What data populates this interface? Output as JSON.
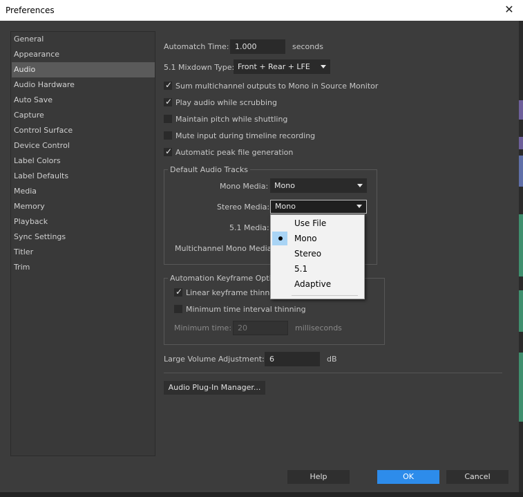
{
  "window": {
    "title": "Preferences",
    "close_icon": "close-icon"
  },
  "sidebar": {
    "items": [
      {
        "label": "General"
      },
      {
        "label": "Appearance"
      },
      {
        "label": "Audio",
        "selected": true
      },
      {
        "label": "Audio Hardware"
      },
      {
        "label": "Auto Save"
      },
      {
        "label": "Capture"
      },
      {
        "label": "Control Surface"
      },
      {
        "label": "Device Control"
      },
      {
        "label": "Label Colors"
      },
      {
        "label": "Label Defaults"
      },
      {
        "label": "Media"
      },
      {
        "label": "Memory"
      },
      {
        "label": "Playback"
      },
      {
        "label": "Sync Settings"
      },
      {
        "label": "Titler"
      },
      {
        "label": "Trim"
      }
    ]
  },
  "audio": {
    "automatch_label": "Automatch Time:",
    "automatch_value": "1.000",
    "automatch_unit": "seconds",
    "mixdown_label": "5.1 Mixdown Type:",
    "mixdown_value": "Front + Rear + LFE",
    "checkboxes": [
      {
        "label": "Sum multichannel outputs to Mono in Source Monitor",
        "checked": true
      },
      {
        "label": "Play audio while scrubbing",
        "checked": true
      },
      {
        "label": "Maintain pitch while shuttling",
        "checked": false
      },
      {
        "label": "Mute input during timeline recording",
        "checked": false
      },
      {
        "label": "Automatic peak file generation",
        "checked": true
      }
    ],
    "default_tracks": {
      "legend": "Default Audio Tracks",
      "mono_label": "Mono Media:",
      "mono_value": "Mono",
      "stereo_label": "Stereo Media:",
      "stereo_value": "Mono",
      "surround_label": "5.1 Media:",
      "multichannel_label": "Multichannel Mono Media:"
    },
    "keyframe": {
      "legend": "Automation Keyframe Optim",
      "linear_label": "Linear keyframe thinning",
      "linear_checked": true,
      "min_interval_label": "Minimum time interval thinning",
      "min_interval_checked": false,
      "min_time_label": "Minimum time:",
      "min_time_value": "20",
      "min_time_unit": "milliseconds"
    },
    "large_volume_label": "Large Volume Adjustment:",
    "large_volume_value": "6",
    "large_volume_unit": "dB",
    "plugin_manager_label": "Audio Plug-In Manager..."
  },
  "stereo_menu": {
    "options": [
      {
        "label": "Use File",
        "selected": false
      },
      {
        "label": "Mono",
        "selected": true
      },
      {
        "label": "Stereo",
        "selected": false
      },
      {
        "label": "5.1",
        "selected": false
      },
      {
        "label": "Adaptive",
        "selected": false
      }
    ]
  },
  "footer": {
    "help_label": "Help",
    "ok_label": "OK",
    "cancel_label": "Cancel"
  },
  "colors": {
    "accent": "#2d8ceb",
    "menu_highlight": "#a9d4f5",
    "selected_item": "#5a5a5a"
  }
}
